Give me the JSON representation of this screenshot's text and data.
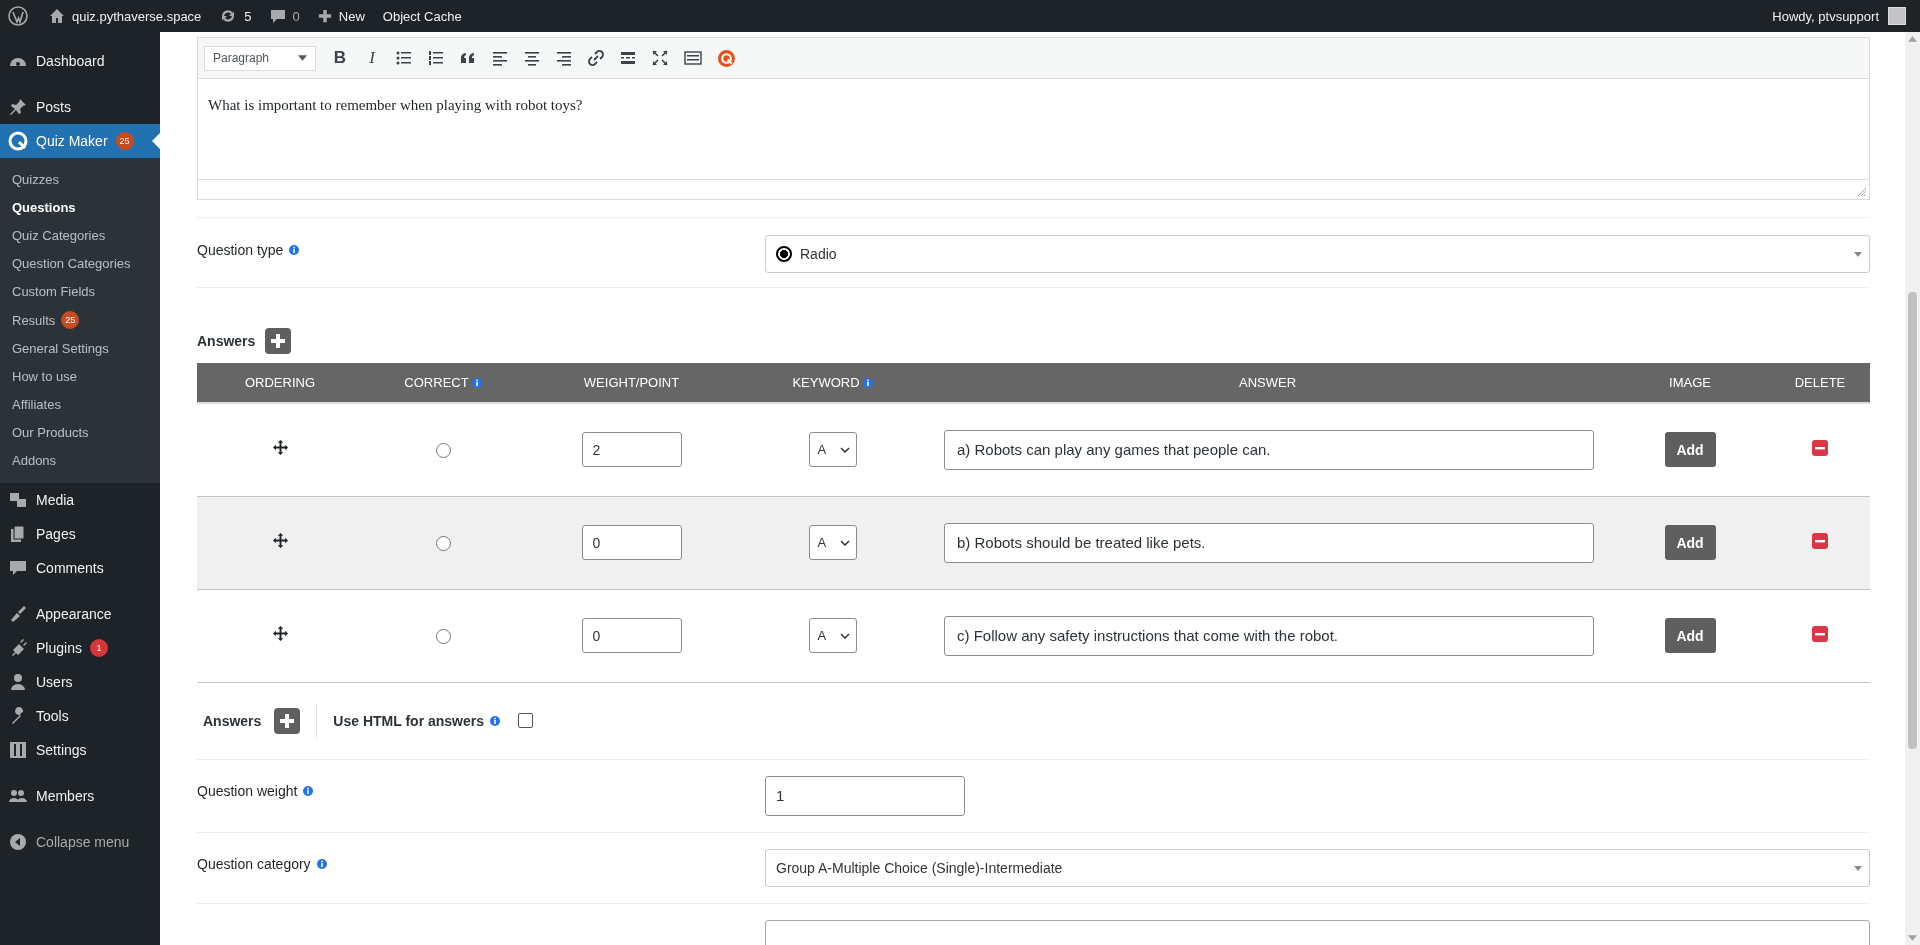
{
  "admin_bar": {
    "site": "quiz.pythaverse.space",
    "updates": "5",
    "comments": "0",
    "new": "New",
    "object_cache": "Object Cache",
    "greeting": "Howdy, ptvsupport"
  },
  "sidebar": {
    "groups": [
      {
        "items": [
          {
            "label": "Dashboard",
            "selected": false
          }
        ]
      },
      {
        "items": [
          {
            "label": "Posts",
            "selected": false
          },
          {
            "label": "Quiz Maker",
            "selected": true,
            "badge": {
              "text": "25",
              "color": "#ca4a1f"
            },
            "children": [
              {
                "label": "Quizzes",
                "selected": false
              },
              {
                "label": "Questions",
                "selected": true
              },
              {
                "label": "Quiz Categories",
                "selected": false
              },
              {
                "label": "Question Categories",
                "selected": false
              },
              {
                "label": "Custom Fields",
                "selected": false
              },
              {
                "label": "Results",
                "selected": false,
                "badge": {
                  "text": "25",
                  "color": "#ca4a1f"
                }
              },
              {
                "label": "General Settings",
                "selected": false
              },
              {
                "label": "How to use",
                "selected": false
              },
              {
                "label": "Affiliates",
                "selected": false
              },
              {
                "label": "Our Products",
                "selected": false
              },
              {
                "label": "Addons",
                "selected": false
              }
            ]
          },
          {
            "label": "Media",
            "selected": false
          },
          {
            "label": "Pages",
            "selected": false
          },
          {
            "label": "Comments",
            "selected": false
          }
        ]
      },
      {
        "items": [
          {
            "label": "Appearance",
            "selected": false
          },
          {
            "label": "Plugins",
            "selected": false,
            "badge": {
              "text": "1",
              "color": "#d63638"
            }
          },
          {
            "label": "Users",
            "selected": false
          },
          {
            "label": "Tools",
            "selected": false
          },
          {
            "label": "Settings",
            "selected": false
          }
        ]
      },
      {
        "items": [
          {
            "label": "Members",
            "selected": false
          }
        ]
      }
    ],
    "collapse": "Collapse menu"
  },
  "editor": {
    "format": "Paragraph",
    "bold": "B",
    "italic": "I",
    "content": "What is important to remember when playing with robot toys?"
  },
  "question_type": {
    "label": "Question type",
    "value": "Radio"
  },
  "answers": {
    "label": "Answers",
    "columns": [
      {
        "label": "ORDERING",
        "info": false
      },
      {
        "label": "CORRECT",
        "info": true
      },
      {
        "label": "WEIGHT/POINT",
        "info": false
      },
      {
        "label": "KEYWORD",
        "info": true
      },
      {
        "label": "ANSWER",
        "info": false
      },
      {
        "label": "IMAGE",
        "info": false
      },
      {
        "label": "DELETE",
        "info": false
      }
    ],
    "rows": [
      {
        "highlighted": false,
        "correct": false,
        "weight": "2",
        "keyword": "A",
        "answer": "a) Robots can play any games that people can.",
        "image_button": "Add"
      },
      {
        "highlighted": true,
        "correct": false,
        "weight": "0",
        "keyword": "A",
        "answer": "b) Robots should be treated like pets.",
        "image_button": "Add"
      },
      {
        "highlighted": false,
        "correct": false,
        "weight": "0",
        "keyword": "A",
        "answer": "c) Follow any safety instructions that come with the robot.",
        "image_button": "Add"
      }
    ]
  },
  "answers_footer": {
    "label": "Answers",
    "html_label": "Use HTML for answers",
    "html_checked": false
  },
  "question_weight": {
    "label": "Question weight",
    "value": "1"
  },
  "question_category": {
    "label": "Question category",
    "value": "Group A-Multiple Choice (Single)-Intermediate"
  }
}
